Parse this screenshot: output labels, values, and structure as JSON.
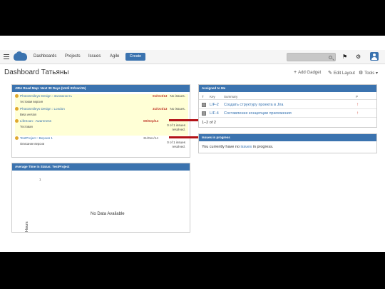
{
  "nav": {
    "links": [
      "Dashboards",
      "Projects",
      "Issues",
      "Agile"
    ],
    "create_label": "Create",
    "search_placeholder": ""
  },
  "dashboard": {
    "title": "Dashboard Татьяны",
    "actions": {
      "add_gadget": "Add Gadget",
      "edit_layout": "Edit Layout",
      "tools": "Tools"
    }
  },
  "roadmap": {
    "title": "JIRA Road Map: Next 30 Days (Until 03/Jan/15)",
    "rows": [
      {
        "version": "PhotoSmileys Design : Залежность",
        "desc": "тестовая версия",
        "date": "01/Oct/13",
        "status": "No issues.",
        "highlight": true
      },
      {
        "version": "PhotoSmileys Design : London",
        "desc": "Beta version",
        "date": "31/Oct/13",
        "status": "No issues.",
        "highlight": true
      },
      {
        "version": "LifeScan : Awareness",
        "desc": "Тестовая",
        "date": "09/Sep/14",
        "status_line1": "0 of 1 issues",
        "status_line2": "resolved.",
        "highlight": true
      },
      {
        "version": "TestProject : Версия 1",
        "desc": "Описание версии",
        "date": "31/Dec/14",
        "status_line1": "0 of 1 issues",
        "status_line2": "resolved.",
        "highlight": false
      }
    ]
  },
  "assigned": {
    "title": "Assigned to Me",
    "columns": {
      "type": "T",
      "key": "Key",
      "summary": "Summary",
      "priority": "P"
    },
    "rows": [
      {
        "key": "LIF-2",
        "summary": "Создать структуру проекта в Jira"
      },
      {
        "key": "LIF-4",
        "summary": "Составление концепции приложения"
      }
    ],
    "count": "1–2 of 2"
  },
  "in_progress": {
    "title": "Issues in progress",
    "text_before": "You currently have no ",
    "link": "issues",
    "text_after": " in progress."
  },
  "avg_time": {
    "title": "Average Time in Status: TestProject",
    "tick": "1",
    "ylabel": "Hours",
    "nodata": "No Data Available"
  }
}
